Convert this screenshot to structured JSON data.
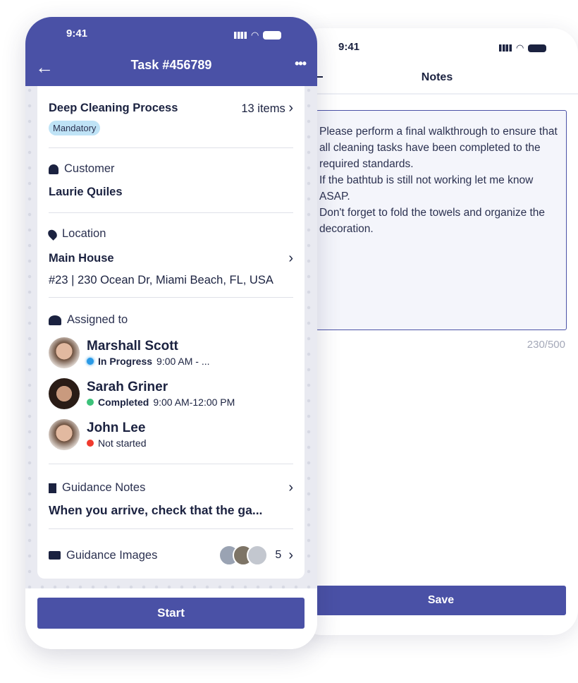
{
  "status_time": "9:41",
  "colors": {
    "primary": "#4a51a6",
    "in_progress": "#2a9ae6",
    "completed": "#3cc27a",
    "not_started": "#f03a2e",
    "badge": "#bfe3f6"
  },
  "notes_screen": {
    "title": "Notes",
    "notes_text": "Please perform a final walkthrough to ensure that all cleaning tasks have been completed to the required standards.\nIf the bathtub is still not working let me know ASAP.\nDon't forget to fold the towels and organize the decoration.",
    "char_count": "230/500",
    "save_label": "Save"
  },
  "task_screen": {
    "title": "Task #456789",
    "checklist": {
      "name": "Deep Cleaning Process",
      "count": "13 items",
      "badge": "Mandatory"
    },
    "customer": {
      "label": "Customer",
      "name": "Laurie Quiles"
    },
    "location": {
      "label": "Location",
      "name": "Main House",
      "address": "#23 | 230 Ocean Dr, Miami Beach, FL, USA"
    },
    "assigned": {
      "label": "Assigned to",
      "people": [
        {
          "name": "Marshall Scott",
          "status": "In Progress",
          "time": "9:00 AM - ..."
        },
        {
          "name": "Sarah Griner",
          "status": "Completed",
          "time": "9:00 AM-12:00 PM"
        },
        {
          "name": "John Lee",
          "status": "Not started",
          "time": ""
        }
      ]
    },
    "guidance_notes": {
      "label": "Guidance Notes",
      "preview": "When you arrive, check that the ga..."
    },
    "guidance_images": {
      "label": "Guidance Images",
      "count": "5"
    },
    "start_label": "Start"
  }
}
